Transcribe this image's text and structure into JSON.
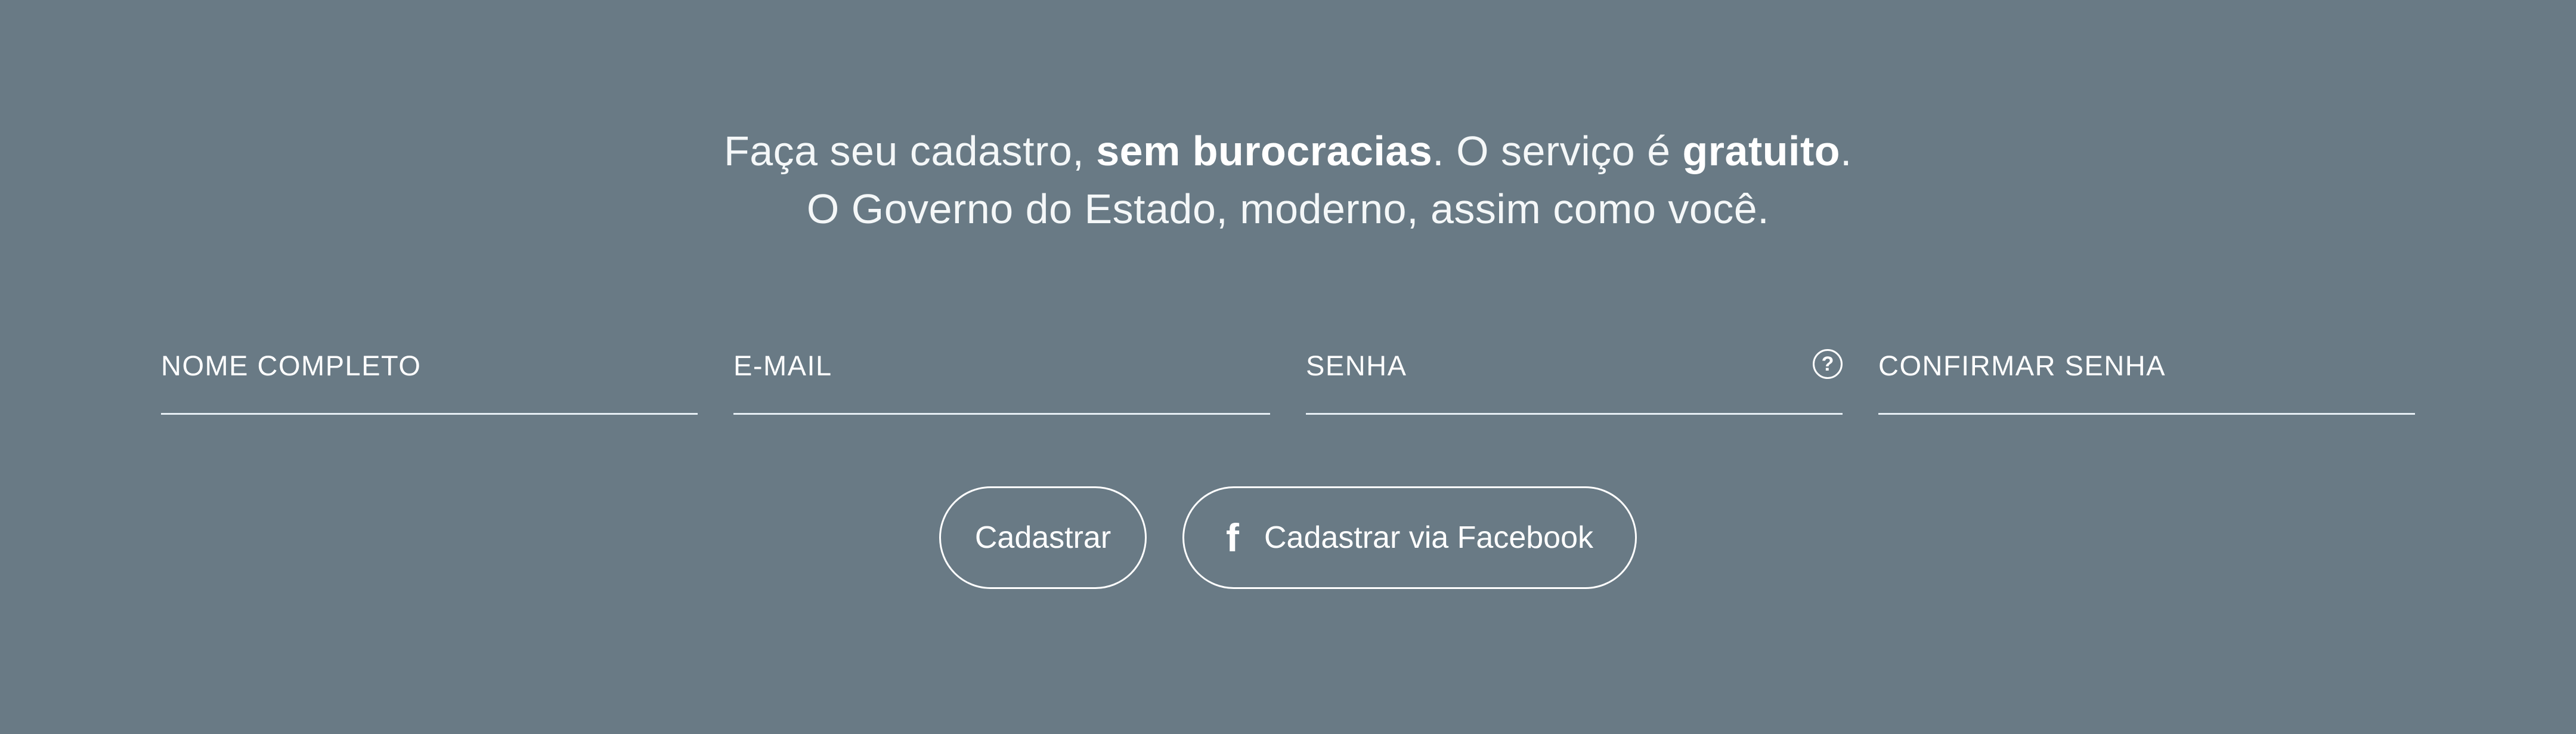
{
  "intro": {
    "line1_part1": "Faça seu cadastro, ",
    "line1_bold1": "sem burocracias",
    "line1_part2": ". O serviço é ",
    "line1_bold2": "gratuito",
    "line1_part3": ".",
    "line2": "O Governo do Estado, moderno, assim como você."
  },
  "form": {
    "fields": [
      {
        "label": "NOME COMPLETO"
      },
      {
        "label": "E-MAIL"
      },
      {
        "label": "SENHA",
        "help_icon": "?"
      },
      {
        "label": "CONFIRMAR SENHA"
      }
    ]
  },
  "buttons": {
    "register_label": "Cadastrar",
    "facebook_label": "Cadastrar via Facebook",
    "facebook_icon": "f"
  },
  "colors": {
    "background": "#697a85",
    "text": "#ffffff",
    "underline": "#e6eef4"
  }
}
